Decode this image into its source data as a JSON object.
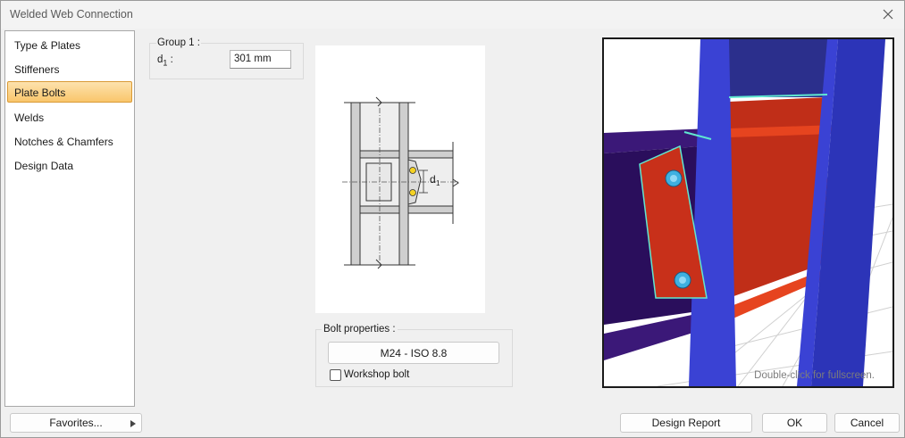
{
  "window": {
    "title": "Welded Web Connection"
  },
  "sidebar": {
    "items": [
      {
        "label": "Type & Plates",
        "active": false
      },
      {
        "label": "Stiffeners",
        "active": false
      },
      {
        "label": "Plate Bolts",
        "active": true
      },
      {
        "label": "Welds",
        "active": false
      },
      {
        "label": "Notches & Chamfers",
        "active": false
      },
      {
        "label": "Design Data",
        "active": false
      }
    ]
  },
  "group1": {
    "title": "Group 1 :",
    "d1_label": "d",
    "d1_sub": "1",
    "d1_colon": ":",
    "d1_value": "301 mm"
  },
  "drawing": {
    "dim_label": "d",
    "dim_sub": "1"
  },
  "bolt_properties": {
    "title": "Bolt properties :",
    "bolt_spec": "M24 - ISO 8.8",
    "workshop_label": "Workshop bolt",
    "workshop_checked": false
  },
  "viewport": {
    "hint": "Double-click for fullscreen."
  },
  "footer": {
    "favorites_label": "Favorites...",
    "design_report_label": "Design Report",
    "ok_label": "OK",
    "cancel_label": "Cancel"
  },
  "colors": {
    "active_item_bg": "#f9c66b",
    "column_blue": "#3a42d4",
    "beam_purple": "#3a1470",
    "plate_red": "#c8301a",
    "bolt_cyan": "#3fb0e0",
    "weld_cyan": "#60e8d0"
  }
}
